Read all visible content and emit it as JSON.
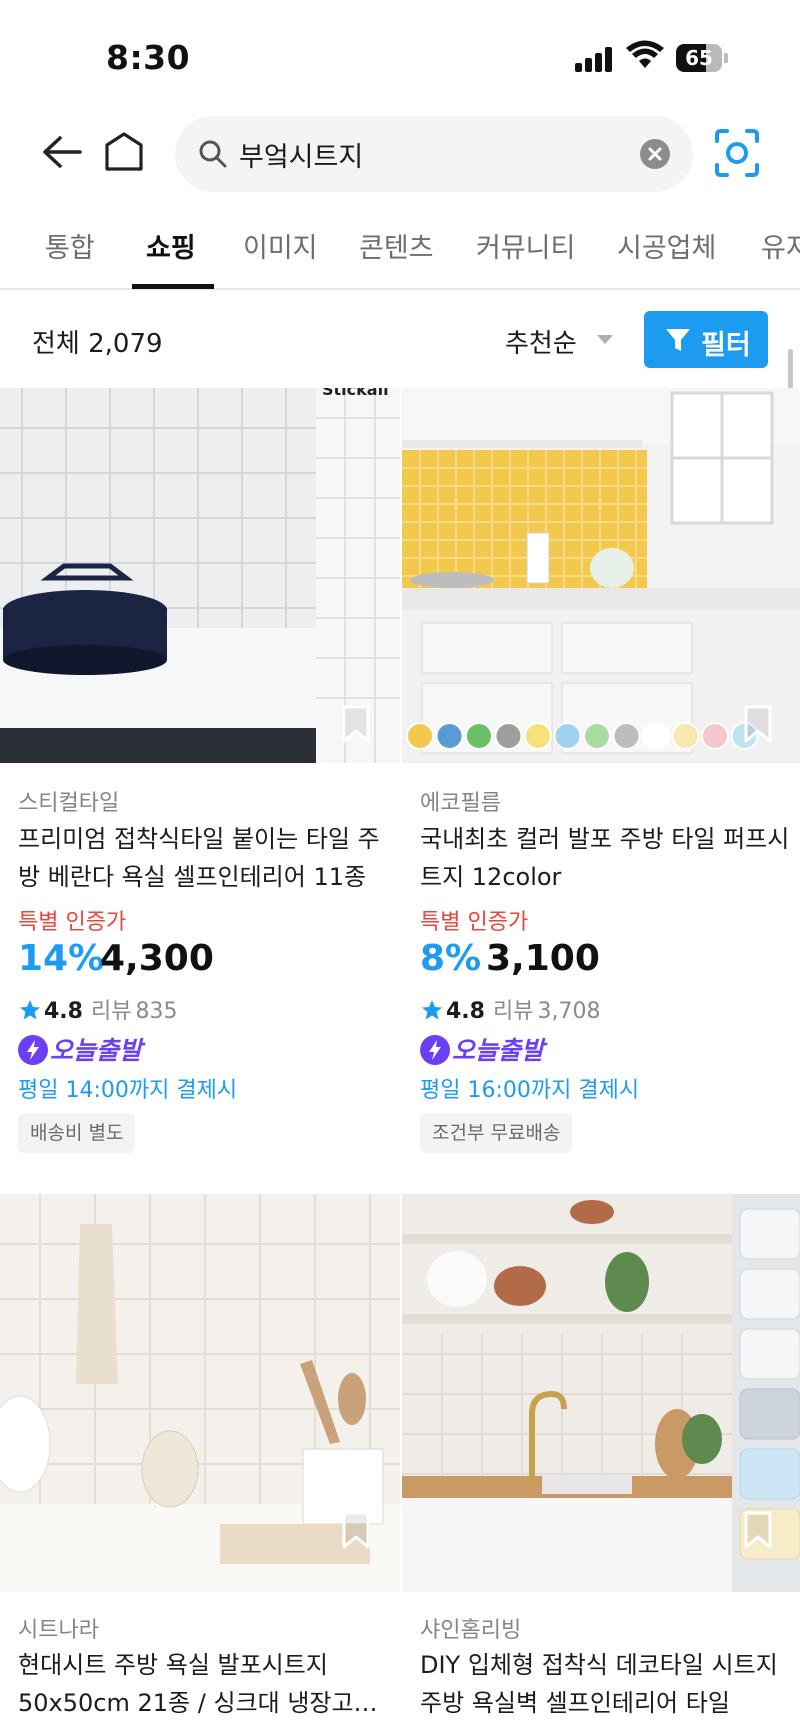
{
  "status": {
    "time": "8:30",
    "battery": "65",
    "battery_level": 0.65
  },
  "search": {
    "query": "부엌시트지",
    "placeholder": ""
  },
  "tabs": [
    {
      "label": "통합",
      "active": false
    },
    {
      "label": "쇼핑",
      "active": true
    },
    {
      "label": "이미지",
      "active": false
    },
    {
      "label": "콘텐츠",
      "active": false
    },
    {
      "label": "커뮤니티",
      "active": false
    },
    {
      "label": "시공업체",
      "active": false
    },
    {
      "label": "유저",
      "active": false
    }
  ],
  "results": {
    "count_label": "전체 2,079",
    "sort_label": "추천순",
    "filter_label": "필터"
  },
  "products": [
    {
      "brand": "스티컬타일",
      "title": "프리미엄 접착식타일 붙이는 타일 주방 베란다 욕실 셀프인테리어 11종",
      "cert": "특별 인증가",
      "discount": "14%",
      "price": "4,300",
      "rating": "4.8",
      "review_label": "리뷰",
      "review_count": "835",
      "today_label": "오늘출발",
      "deadline": "평일 14:00까지 결제시",
      "shipping": "배송비 별도",
      "image_text": "Stickall"
    },
    {
      "brand": "에코필름",
      "title": "국내최초 컬러 발포 주방 타일 퍼프시트지 12color",
      "cert": "특별 인증가",
      "discount": "8%",
      "price": "3,100",
      "rating": "4.8",
      "review_label": "리뷰",
      "review_count": "3,708",
      "today_label": "오늘출발",
      "deadline": "평일 16:00까지 결제시",
      "shipping": "조건부 무료배송"
    },
    {
      "brand": "시트나라",
      "title": "현대시트 주방 욕실 발포시트지 50x50cm 21종 / 싱크대 냉장고…"
    },
    {
      "brand": "샤인홈리빙",
      "title": "DIY 입체형 접착식 데코타일 시트지 주방 욕실벽 셀프인테리어 타일"
    }
  ],
  "colors": {
    "accent": "#1d9bf0",
    "cert_red": "#e6463c",
    "today_purple": "#6a3ff5",
    "swatches": [
      "#f2c94c",
      "#5b9bd5",
      "#6abf69",
      "#9e9e9e",
      "#f6e27a",
      "#9fd3f0",
      "#a8dca0",
      "#bdbdbd",
      "#ffffff",
      "#f7e7b0",
      "#f6c6cf",
      "#bfe3f0"
    ]
  },
  "icons": [
    "back-arrow-icon",
    "home-icon",
    "search-icon",
    "clear-icon",
    "camera-search-icon",
    "chevron-down-icon",
    "filter-icon",
    "bookmark-icon",
    "star-icon",
    "bolt-icon"
  ]
}
